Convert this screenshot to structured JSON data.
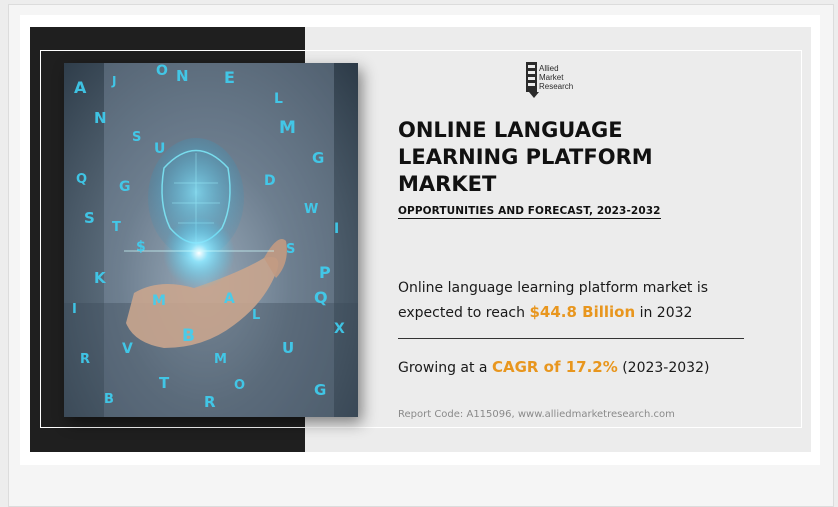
{
  "logo": {
    "lines": [
      "Allied",
      "Market",
      "Research"
    ]
  },
  "title": {
    "line1": "ONLINE LANGUAGE",
    "line2": "LEARNING PLATFORM",
    "line3": "MARKET"
  },
  "subtitle": "OPPORTUNITIES AND FORECAST, 2023-2032",
  "stat1": {
    "prefix": "Online language learning platform market is expected to reach ",
    "value": "$44.8 Billion",
    "suffix": " in 2032"
  },
  "stat2": {
    "prefix": "Growing at a ",
    "value": "CAGR of 17.2%",
    "suffix": " (2023-2032)"
  },
  "footer": "Report Code: A115096, www.alliedmarketresearch.com",
  "colors": {
    "accent": "#e8961e",
    "dark_panel": "#1f1f1f",
    "light_panel": "#ececec",
    "glow": "#40c8f0"
  },
  "image": {
    "subject": "hand-holding-glowing-ai-head-with-floating-letters"
  }
}
